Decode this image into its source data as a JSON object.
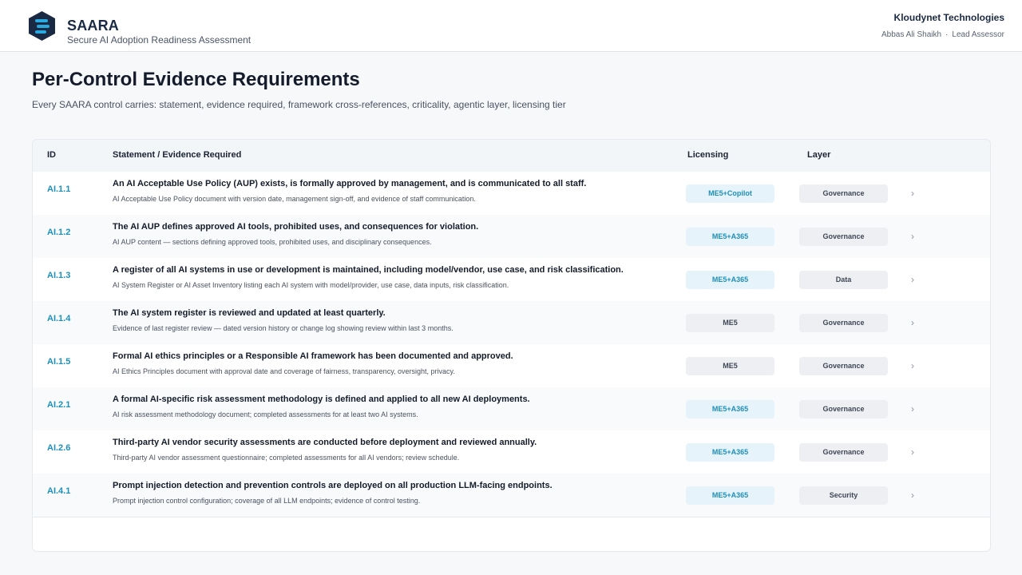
{
  "header": {
    "app_name": "SAARA",
    "app_subtitle": "Secure AI Adoption Readiness Assessment",
    "org_name": "Kloudynet Technologies",
    "user_name": "Abbas Ali Shaikh",
    "separator": "·",
    "user_role": "Lead Assessor",
    "logo_icon": "hexagon-list-icon",
    "brand_color": "#1b2a44",
    "logo_accent": "#29a9e0"
  },
  "page": {
    "title": "Per-Control Evidence Requirements",
    "subtitle": "Every SAARA control carries: statement, evidence required, framework cross-references, criticality, agentic layer, licensing tier"
  },
  "table": {
    "columns": {
      "id": "ID",
      "statement": "Statement / Evidence Required",
      "licensing": "Licensing",
      "layer": "Layer"
    },
    "row_icon": "chevron-right-icon",
    "rows": [
      {
        "id": "AI.1.1",
        "statement": "An AI Acceptable Use Policy (AUP) exists, is formally approved by management, and is communicated to all staff.",
        "evidence": "AI Acceptable Use Policy document with version date, management sign-off, and evidence of staff communication.",
        "licensing": "ME5+Copilot",
        "licensing_style": "blue",
        "layer": "Governance",
        "chevron": "›"
      },
      {
        "id": "AI.1.2",
        "statement": "The AI AUP defines approved AI tools, prohibited uses, and consequences for violation.",
        "evidence": "AI AUP content — sections defining approved tools, prohibited uses, and disciplinary consequences.",
        "licensing": "ME5+A365",
        "licensing_style": "blue",
        "layer": "Governance",
        "chevron": "›"
      },
      {
        "id": "AI.1.3",
        "statement": "A register of all AI systems in use or development is maintained, including model/vendor, use case, and risk classification.",
        "evidence": "AI System Register or AI Asset Inventory listing each AI system with model/provider, use case, data inputs, risk classification.",
        "licensing": "ME5+A365",
        "licensing_style": "blue",
        "layer": "Data",
        "chevron": "›"
      },
      {
        "id": "AI.1.4",
        "statement": "The AI system register is reviewed and updated at least quarterly.",
        "evidence": "Evidence of last register review — dated version history or change log showing review within last 3 months.",
        "licensing": "ME5",
        "licensing_style": "grey",
        "layer": "Governance",
        "chevron": "›"
      },
      {
        "id": "AI.1.5",
        "statement": "Formal AI ethics principles or a Responsible AI framework has been documented and approved.",
        "evidence": "AI Ethics Principles document with approval date and coverage of fairness, transparency, oversight, privacy.",
        "licensing": "ME5",
        "licensing_style": "grey",
        "layer": "Governance",
        "chevron": "›"
      },
      {
        "id": "AI.2.1",
        "statement": "A formal AI-specific risk assessment methodology is defined and applied to all new AI deployments.",
        "evidence": "AI risk assessment methodology document; completed assessments for at least two AI systems.",
        "licensing": "ME5+A365",
        "licensing_style": "blue",
        "layer": "Governance",
        "chevron": "›"
      },
      {
        "id": "AI.2.6",
        "statement": "Third-party AI vendor security assessments are conducted before deployment and reviewed annually.",
        "evidence": "Third-party AI vendor assessment questionnaire; completed assessments for all AI vendors; review schedule.",
        "licensing": "ME5+A365",
        "licensing_style": "blue",
        "layer": "Governance",
        "chevron": "›"
      },
      {
        "id": "AI.4.1",
        "statement": "Prompt injection detection and prevention controls are deployed on all production LLM-facing endpoints.",
        "evidence": "Prompt injection control configuration; coverage of all LLM endpoints; evidence of control testing.",
        "licensing": "ME5+A365",
        "licensing_style": "blue",
        "layer": "Security",
        "chevron": "›"
      }
    ]
  }
}
